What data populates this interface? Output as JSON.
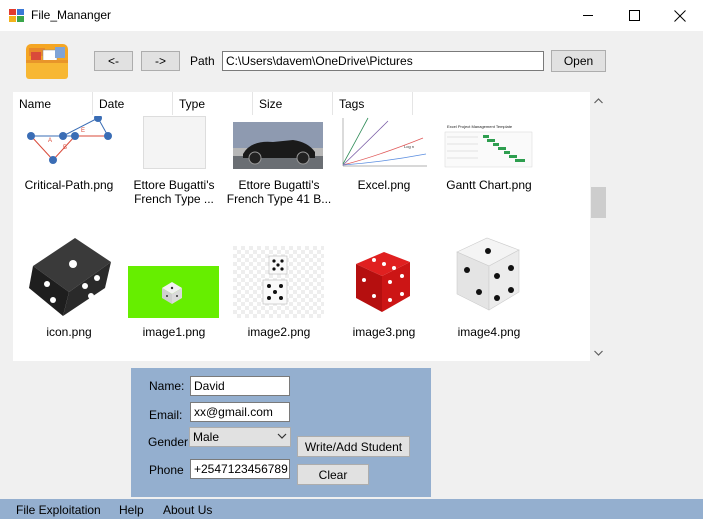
{
  "window": {
    "title": "File_Mananger"
  },
  "toolbar": {
    "back_label": "<-",
    "forward_label": "->",
    "path_label": "Path",
    "path_value": "C:\\Users\\davem\\OneDrive\\Pictures",
    "open_label": "Open"
  },
  "list": {
    "columns": [
      "Name",
      "Date",
      "Type",
      "Size",
      "Tags"
    ],
    "items": [
      {
        "label": "Critical-Path.png",
        "thumb": "critical-path-diagram"
      },
      {
        "label": "Ettore Bugatti's French Type ...",
        "thumb": "blank-white"
      },
      {
        "label": "Ettore Bugatti's French Type 41 B...",
        "thumb": "vintage-car"
      },
      {
        "label": "Excel.png",
        "thumb": "line-chart"
      },
      {
        "label": "Gantt Chart.png",
        "thumb": "gantt-chart"
      },
      {
        "label": "icon.png",
        "thumb": "black-dice"
      },
      {
        "label": "image1.png",
        "thumb": "dice-green-bg"
      },
      {
        "label": "image2.png",
        "thumb": "white-dice-pair"
      },
      {
        "label": "image3.png",
        "thumb": "red-dice"
      },
      {
        "label": "image4.png",
        "thumb": "white-dice"
      }
    ]
  },
  "form": {
    "name_label": "Name:",
    "name_value": "David",
    "email_label": "Email:",
    "email_value": "xx@gmail.com",
    "gender_label": "Gender:",
    "gender_value": "Male",
    "phone_label": "Phone",
    "phone_value": "+2547123456789",
    "write_button": "Write/Add Student",
    "clear_button": "Clear"
  },
  "menu": {
    "items": [
      "File Exploitation",
      "Help",
      "About Us"
    ]
  },
  "colors": {
    "panel": "#94afcf",
    "window_bg": "#f0f0f0",
    "button_bg": "#e1e1e1"
  }
}
